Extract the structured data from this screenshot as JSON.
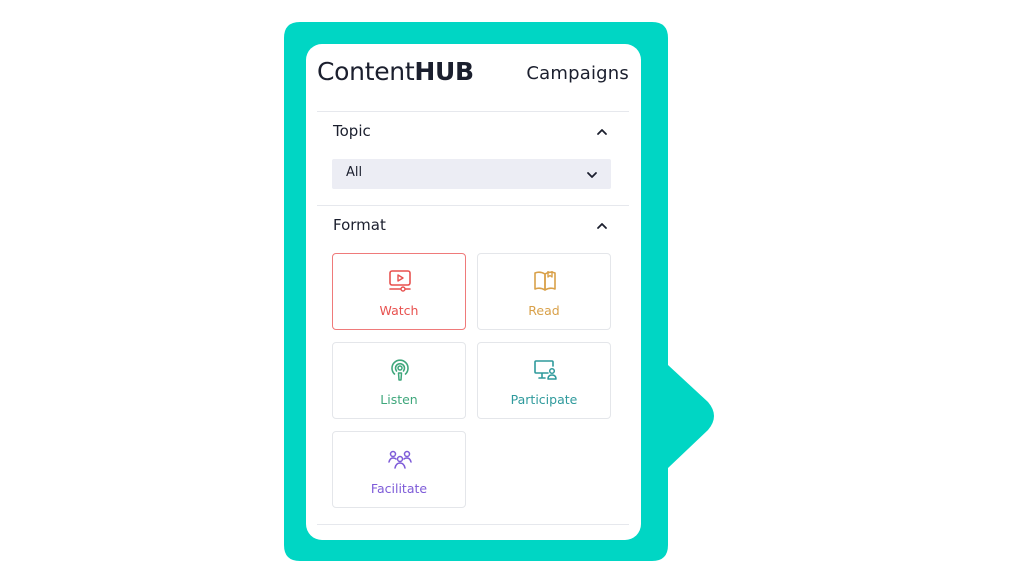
{
  "colors": {
    "frame": "#00d6c4",
    "watch": "#e8514f",
    "read": "#d9a14a",
    "listen": "#3fa77c",
    "participate": "#2f9a9c",
    "facilitate": "#7d5bd8",
    "select_bg": "#ecedf4",
    "text": "#1b1f2e"
  },
  "header": {
    "brand_regular": "Content",
    "brand_bold": "HUB",
    "campaigns_link": "Campaigns"
  },
  "filters": {
    "topic": {
      "title": "Topic",
      "selected": "All",
      "expanded": true
    },
    "format": {
      "title": "Format",
      "expanded": true,
      "options": [
        {
          "label": "Watch",
          "icon": "video-icon",
          "selected": true
        },
        {
          "label": "Read",
          "icon": "book-icon",
          "selected": false
        },
        {
          "label": "Listen",
          "icon": "podcast-icon",
          "selected": false
        },
        {
          "label": "Participate",
          "icon": "monitor-user-icon",
          "selected": false
        },
        {
          "label": "Facilitate",
          "icon": "group-icon",
          "selected": false
        }
      ]
    }
  }
}
